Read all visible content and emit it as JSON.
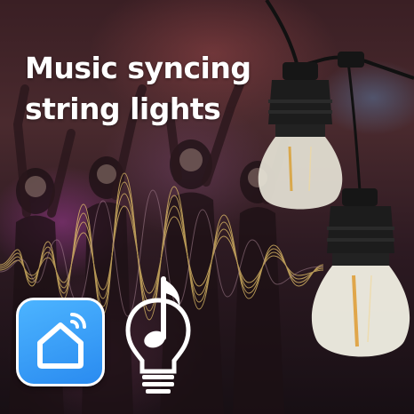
{
  "headline": {
    "line1": "Music syncing",
    "line2": "string lights"
  },
  "icons": {
    "app": "smart-home-app-icon",
    "bulb": "bulb-music-note-icon"
  },
  "colors": {
    "app_icon_blue": "#2a8bf0",
    "sound_wave": "#e8c46a",
    "headline_text": "#ffffff"
  }
}
